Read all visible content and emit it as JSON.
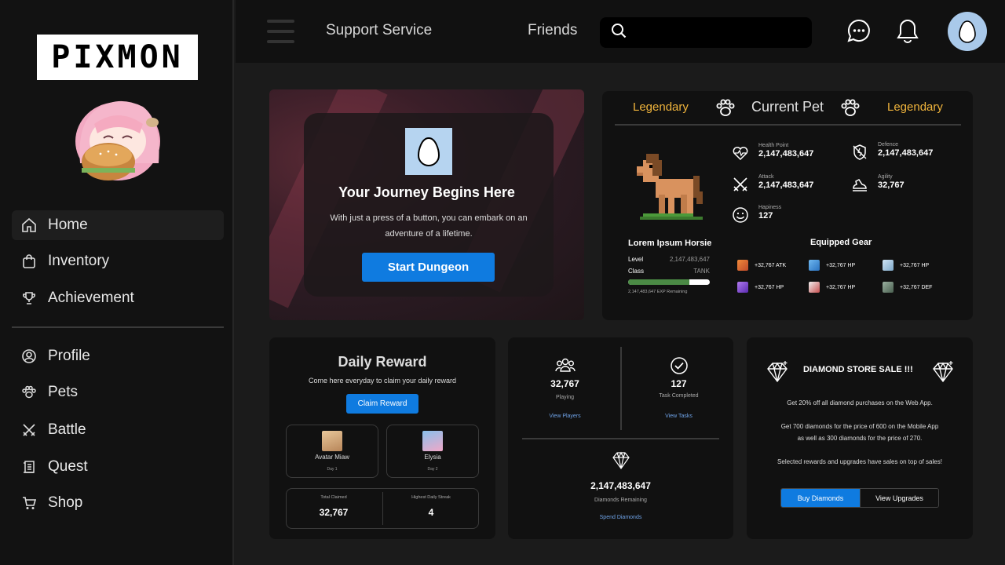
{
  "app": {
    "logo_text": "PIXMON"
  },
  "sidebar": {
    "items": [
      {
        "label": "Home",
        "icon": "home-icon",
        "active": true
      },
      {
        "label": "Inventory",
        "icon": "bag-icon"
      },
      {
        "label": "Achievement",
        "icon": "trophy-icon"
      },
      {
        "label": "Profile",
        "icon": "user-icon"
      },
      {
        "label": "Pets",
        "icon": "paw-icon"
      },
      {
        "label": "Battle",
        "icon": "swords-icon"
      },
      {
        "label": "Quest",
        "icon": "scroll-icon"
      },
      {
        "label": "Shop",
        "icon": "cart-icon"
      }
    ]
  },
  "topbar": {
    "links": [
      "Support Service",
      "Friends"
    ],
    "search_placeholder": "",
    "icons": [
      "chat-icon",
      "bell-icon",
      "egg-avatar-icon"
    ]
  },
  "hero": {
    "title": "Your Journey Begins Here",
    "desc": "With just a press of a button, you can embark on an adventure of a lifetime.",
    "button": "Start Dungeon"
  },
  "pet": {
    "rarity_left": "Legendary",
    "title": "Current Pet",
    "rarity_right": "Legendary",
    "name": "Lorem Ipsum Horsie",
    "level_label": "Level",
    "level_value": "2,147,483,647",
    "class_label": "Class",
    "class_value": "TANK",
    "exp_progress": 0.75,
    "exp_text": "2,147,483,647 EXP Remaining",
    "stats": {
      "hp": {
        "label": "Health Point",
        "value": "2,147,483,647"
      },
      "def": {
        "label": "Defence",
        "value": "2,147,483,647"
      },
      "atk": {
        "label": "Attack",
        "value": "2,147,483,647"
      },
      "agi": {
        "label": "Agility",
        "value": "32,767"
      },
      "hap": {
        "label": "Hapiness",
        "value": "127"
      }
    },
    "gear_title": "Equipped Gear",
    "gear": [
      "+32,767 ATK",
      "+32,767 HP",
      "+32,767 HP",
      "+32,767 HP",
      "+32,767 HP",
      "+32,767 DEF"
    ],
    "colors": {
      "rarity": "#f0b43c",
      "exp": "#4b8a45"
    }
  },
  "daily": {
    "title": "Daily Reward",
    "subtitle": "Come here everyday to claim your daily reward",
    "button": "Claim Reward",
    "rewards": [
      {
        "name": "Avatar Miaw",
        "day": "Day 1"
      },
      {
        "name": "Elysia",
        "day": "Day 2"
      }
    ],
    "total_label": "Total Claimed",
    "total_value": "32,767",
    "streak_label": "Highest Daily Streak",
    "streak_value": "4"
  },
  "stats": {
    "playing": {
      "value": "32,767",
      "label": "Playing",
      "link": "View Players"
    },
    "tasks": {
      "value": "127",
      "label": "Task Completed",
      "link": "View Tasks"
    },
    "diamonds": {
      "value": "2,147,483,647",
      "label": "Diamonds Remaining",
      "link": "Spend Diamonds"
    }
  },
  "store": {
    "title": "DIAMOND STORE SALE !!!",
    "line1": "Get 20% off all diamond purchases on the Web App.",
    "line2": "Get 700 diamonds for the price of 600 on the Mobile App",
    "line3": "as well as 300 diamonds for the price of 270.",
    "line4": "Selected rewards and upgrades have sales on top of sales!",
    "btn_buy": "Buy Diamonds",
    "btn_upgrades": "View Upgrades"
  }
}
